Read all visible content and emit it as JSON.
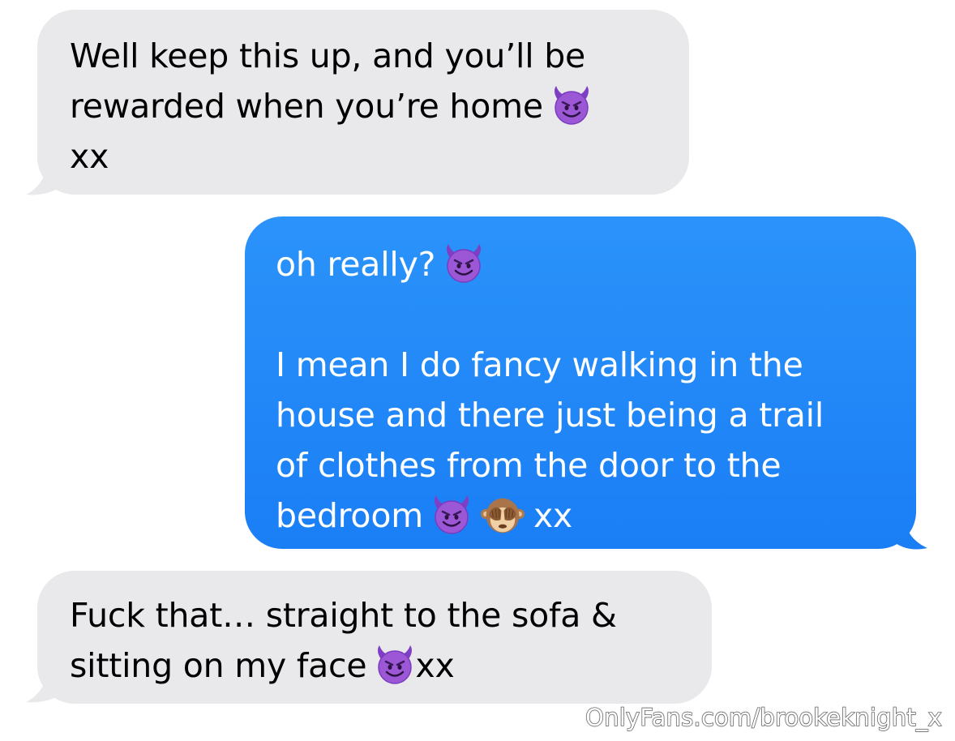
{
  "conversation": {
    "messages": [
      {
        "direction": "incoming",
        "line1": "Well keep this up, and you’ll be",
        "line2": "rewarded when you’re home",
        "line3": "xx"
      },
      {
        "direction": "outgoing",
        "line1": "oh really?",
        "line2": "I mean I do fancy walking in the",
        "line3": "house and there just being a trail",
        "line4": "of clothes from the door to the",
        "line5": "bedroom",
        "line5_tail": "xx"
      },
      {
        "direction": "incoming",
        "line1": "Fuck that… straight to the sofa &",
        "line2": "sitting on my face",
        "line2_tail": "xx"
      }
    ]
  },
  "watermark": "OnlyFans.com/brookeknight_x",
  "icons": {
    "devil": "smiling-face-with-horns-icon",
    "monkey": "see-no-evil-monkey-icon"
  },
  "colors": {
    "incoming_bubble": "#e9e9eb",
    "outgoing_bubble": "#1d8cf8",
    "incoming_text": "#000000",
    "outgoing_text": "#ffffff",
    "devil_emoji": "#8e4ecf"
  }
}
